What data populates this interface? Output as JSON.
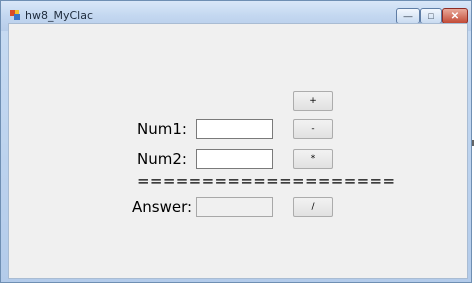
{
  "window": {
    "title": "hw8_MyClac",
    "controls": {
      "minimize": "—",
      "maximize": "□",
      "close": "✕"
    }
  },
  "form": {
    "num1_label": "Num1:",
    "num2_label": "Num2:",
    "separator": "====================",
    "answer_label": "Answer:",
    "num1_value": "",
    "num2_value": "",
    "answer_value": "",
    "buttons": {
      "add": "+",
      "subtract": "-",
      "multiply": "*",
      "divide": "/"
    }
  },
  "colors": {
    "client_bg": "#f0f0f0",
    "titlebar": "#c3d7f0",
    "close_button": "#c24a36"
  }
}
